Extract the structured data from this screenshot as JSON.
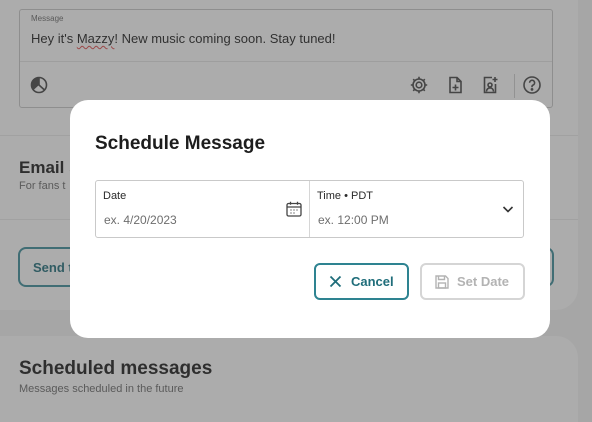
{
  "composer": {
    "field_label": "Message",
    "text_before": "Hey it's ",
    "text_misspelled": "Mazzy",
    "text_after": "! New music coming soon. Stay tuned!"
  },
  "toolbar_icons": [
    "pie-chart-icon",
    "settings-gear-icon",
    "add-file-icon",
    "image-person-icon",
    "help-icon"
  ],
  "email_section": {
    "title": "Email s",
    "subtitle": "For fans t"
  },
  "send_button": {
    "label": "Send t"
  },
  "scheduled": {
    "title": "Scheduled messages",
    "subtitle": "Messages scheduled in the future"
  },
  "modal": {
    "title": "Schedule Message",
    "date_label": "Date",
    "date_placeholder": "ex. 4/20/2023",
    "time_label": "Time • PDT",
    "time_placeholder": "ex. 12:00 PM",
    "cancel_label": "Cancel",
    "set_date_label": "Set Date"
  },
  "colors": {
    "accent": "#2e8391",
    "accent_text": "#1f6d7a",
    "disabled": "#b3b3b3",
    "overlay": "rgba(70,70,70,0.45)"
  }
}
